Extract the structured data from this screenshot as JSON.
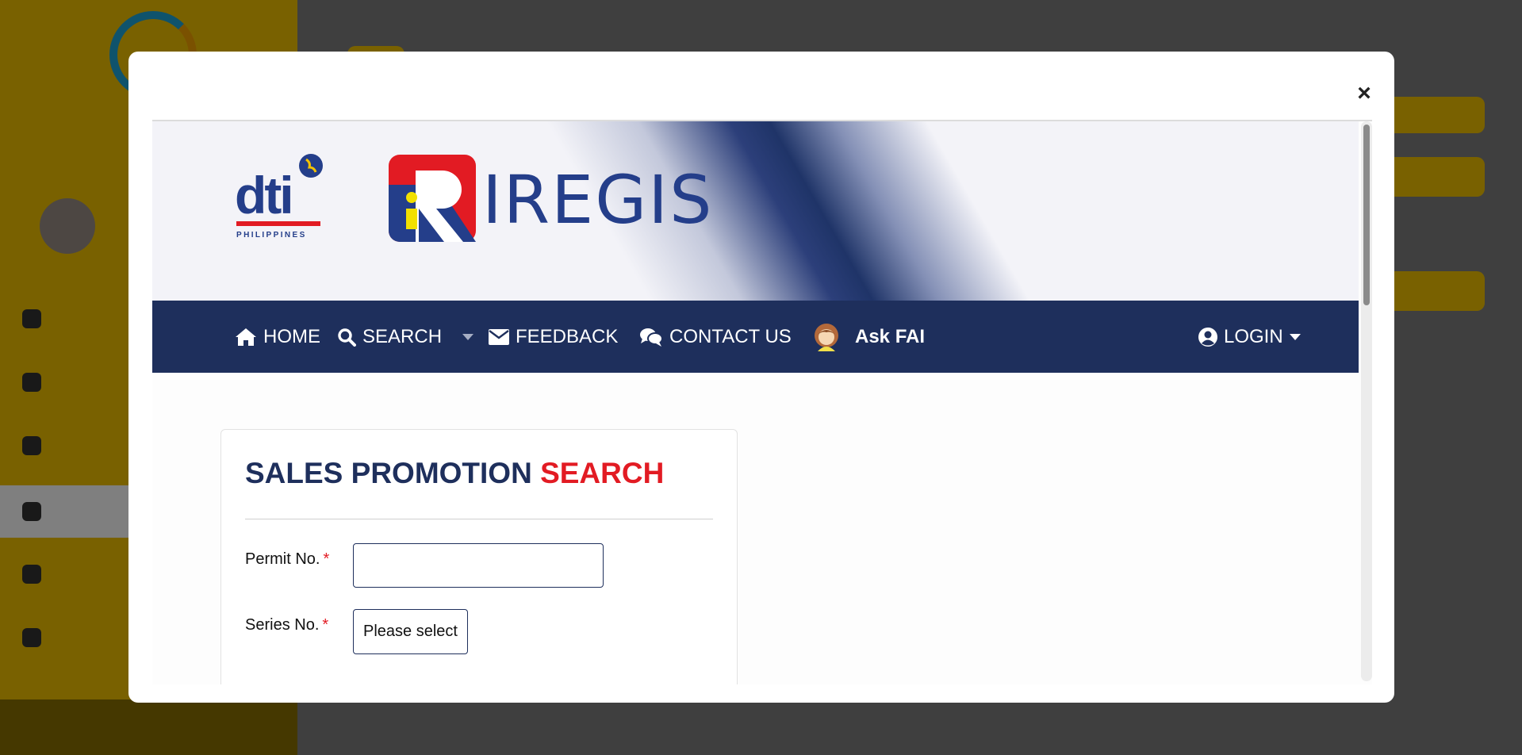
{
  "modal": {
    "close_label": "×"
  },
  "header": {
    "dti_logo_text": "dti",
    "dti_logo_sub": "PHILIPPINES",
    "app_name": "IREGIS"
  },
  "navbar": {
    "home_label": "HOME",
    "search_label": "SEARCH",
    "feedback_label": "FEEDBACK",
    "contact_label": "CONTACT US",
    "askfai_label": "Ask FAI",
    "login_label": "LOGIN"
  },
  "form": {
    "title_main": "SALES PROMOTION ",
    "title_accent": "SEARCH",
    "permit_label": "Permit No.",
    "permit_value": "",
    "series_label": "Series No.",
    "series_selected": "Please select",
    "required_mark": "*"
  },
  "colors": {
    "navy": "#1e2f5c",
    "red": "#e21b23",
    "brand_blue": "#243e8a",
    "sidebar_yellow": "#f2c200"
  },
  "icons": [
    "close-icon",
    "home-icon",
    "search-icon",
    "envelope-icon",
    "comments-icon",
    "user-circle-icon",
    "chevron-down-icon"
  ]
}
